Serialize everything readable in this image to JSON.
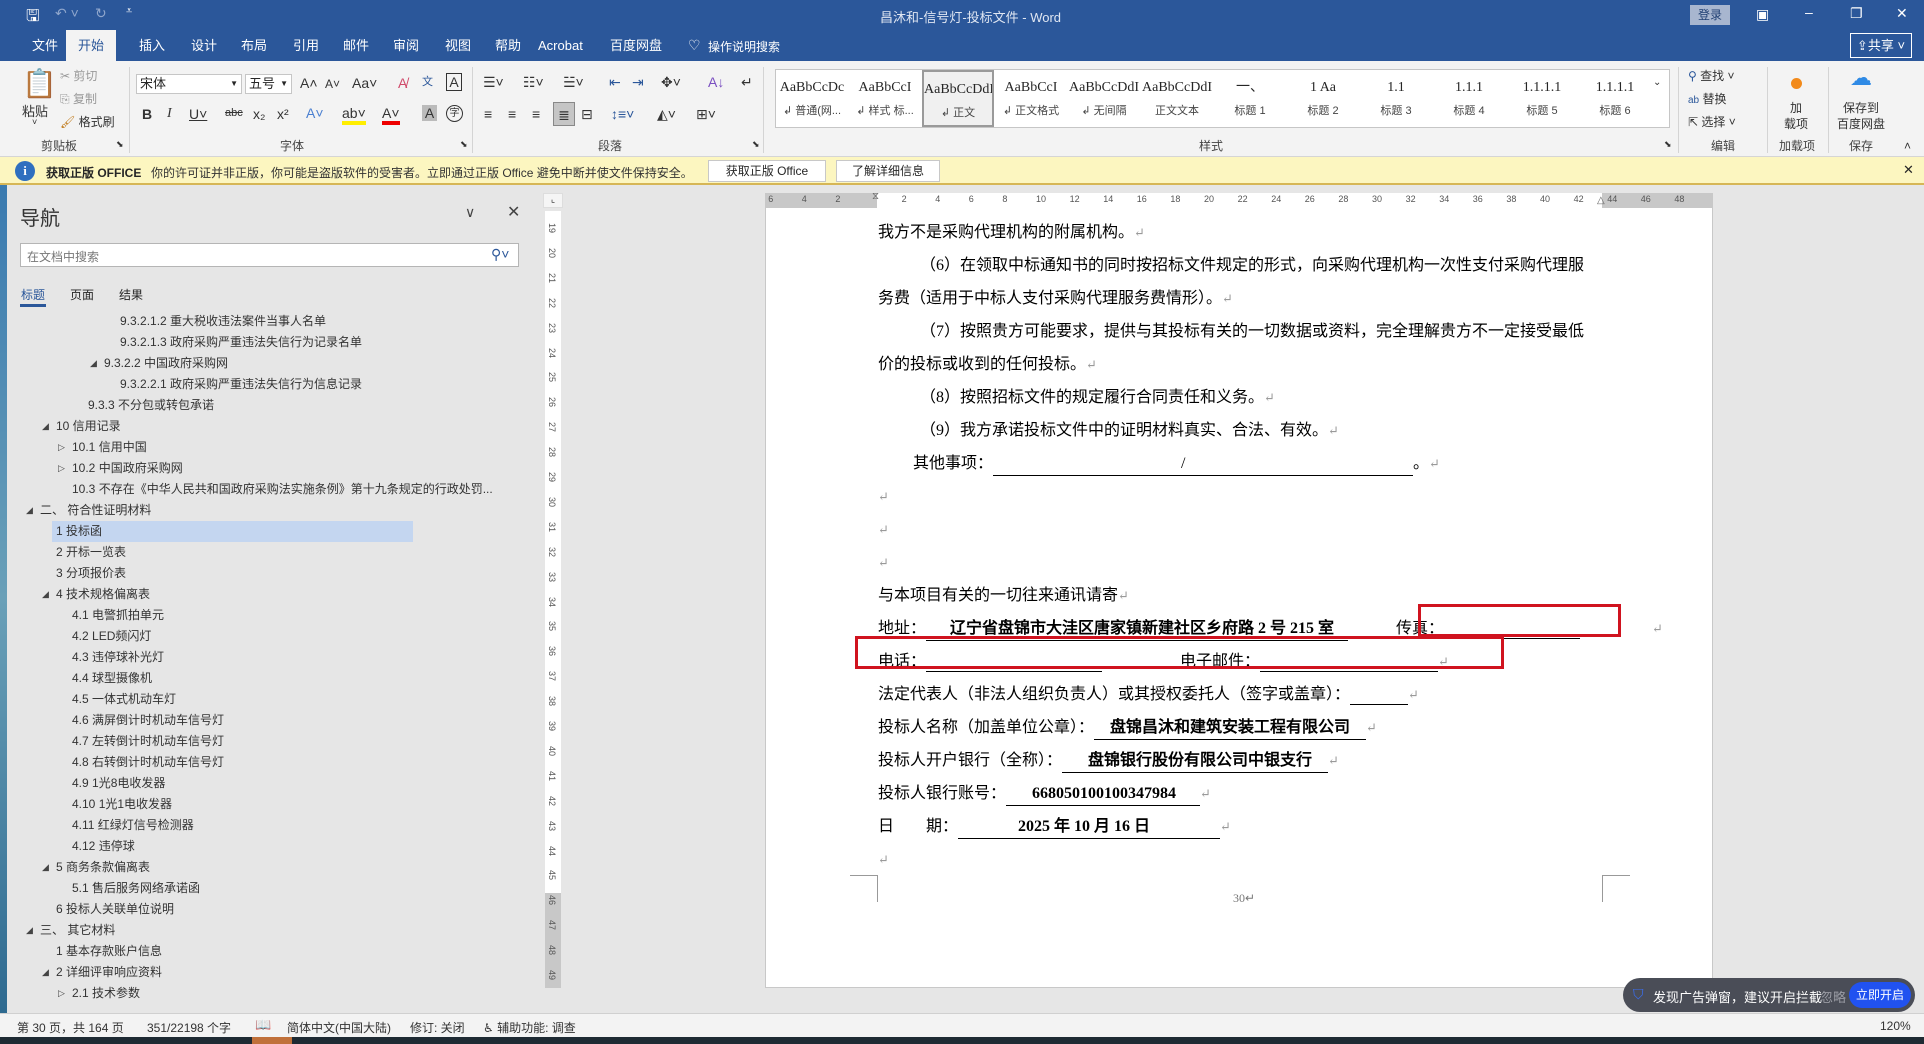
{
  "titlebar": {
    "title": "昌沐和-信号灯-投标文件 - Word",
    "login": "登录",
    "quick_access": [
      "save-icon",
      "undo-icon",
      "redo-icon",
      "customize-icon"
    ]
  },
  "tabs": [
    "文件",
    "开始",
    "插入",
    "设计",
    "布局",
    "引用",
    "邮件",
    "审阅",
    "视图",
    "帮助",
    "Acrobat",
    "百度网盘"
  ],
  "tell_me": "操作说明搜索",
  "share": "共享",
  "ribbon": {
    "clipboard": {
      "label": "剪贴板",
      "paste": "粘贴",
      "cut": "剪切",
      "copy": "复制",
      "format_painter": "格式刷"
    },
    "font": {
      "label": "字体",
      "font_name": "宋体",
      "font_size": "五号"
    },
    "paragraph": {
      "label": "段落"
    },
    "styles": {
      "label": "样式",
      "items": [
        {
          "preview": "AaBbCcDc",
          "label": "↲ 普通(网..."
        },
        {
          "preview": "AaBbCcI",
          "label": "↲ 样式 标..."
        },
        {
          "preview": "AaBbCcDdI",
          "label": "↲ 正文"
        },
        {
          "preview": "AaBbCcI",
          "label": "↲ 正文格式"
        },
        {
          "preview": "AaBbCcDdI",
          "label": "↲ 无间隔"
        },
        {
          "preview": "AaBbCcDdI",
          "label": "正文文本"
        },
        {
          "preview": "一、",
          "label": "标题 1"
        },
        {
          "preview": "1  Aa",
          "label": "标题 2"
        },
        {
          "preview": "1.1",
          "label": "标题 3"
        },
        {
          "preview": "1.1.1",
          "label": "标题 4"
        },
        {
          "preview": "1.1.1.1",
          "label": "标题 5"
        },
        {
          "preview": "1.1.1.1",
          "label": "标题 6"
        }
      ]
    },
    "editing": {
      "label": "编辑",
      "find": "查找",
      "replace": "替换",
      "select": "选择"
    },
    "addins": {
      "label": "加载项",
      "button_line1": "加",
      "button_line2": "载项"
    },
    "save": {
      "label": "保存",
      "button_line1": "保存到",
      "button_line2": "百度网盘"
    }
  },
  "message_bar": {
    "title": "获取正版 OFFICE",
    "text": "你的许可证并非正版，你可能是盗版软件的受害者。立即通过正版 Office 避免中断并使文件保持安全。",
    "btn_genuine": "获取正版 Office",
    "btn_learn": "了解详细信息"
  },
  "nav": {
    "title": "导航",
    "search_placeholder": "在文档中搜索",
    "tabs": [
      "标题",
      "页面",
      "结果"
    ],
    "items": [
      {
        "text": "9.3.2.1.2 重大税收违法案件当事人名单",
        "level": 5,
        "toggle": ""
      },
      {
        "text": "9.3.2.1.3 政府采购严重违法失信行为记录名单",
        "level": 5,
        "toggle": ""
      },
      {
        "text": "9.3.2.2 中国政府采购网",
        "level": 4,
        "toggle": "expanded"
      },
      {
        "text": "9.3.2.2.1 政府采购严重违法失信行为信息记录",
        "level": 5,
        "toggle": ""
      },
      {
        "text": "9.3.3 不分包或转包承诺",
        "level": 3,
        "toggle": ""
      },
      {
        "text": "10 信用记录",
        "level": 1,
        "toggle": "expanded"
      },
      {
        "text": "10.1 信用中国",
        "level": 2,
        "toggle": "collapsed"
      },
      {
        "text": "10.2 中国政府采购网",
        "level": 2,
        "toggle": "collapsed"
      },
      {
        "text": "10.3 不存在《中华人民共和国政府采购法实施条例》第十九条规定的行政处罚...",
        "level": 2,
        "toggle": ""
      },
      {
        "text": "二、 符合性证明材料",
        "level": 0,
        "toggle": "expanded"
      },
      {
        "text": "1 投标函",
        "level": 1,
        "toggle": "",
        "selected": true
      },
      {
        "text": "2 开标一览表",
        "level": 1,
        "toggle": ""
      },
      {
        "text": "3 分项报价表",
        "level": 1,
        "toggle": ""
      },
      {
        "text": "4 技术规格偏离表",
        "level": 1,
        "toggle": "expanded"
      },
      {
        "text": "4.1 电警抓拍单元",
        "level": 2,
        "toggle": ""
      },
      {
        "text": "4.2 LED频闪灯",
        "level": 2,
        "toggle": ""
      },
      {
        "text": "4.3 违停球补光灯",
        "level": 2,
        "toggle": ""
      },
      {
        "text": "4.4 球型摄像机",
        "level": 2,
        "toggle": ""
      },
      {
        "text": "4.5 一体式机动车灯",
        "level": 2,
        "toggle": ""
      },
      {
        "text": "4.6 满屏倒计时机动车信号灯",
        "level": 2,
        "toggle": ""
      },
      {
        "text": "4.7 左转倒计时机动车信号灯",
        "level": 2,
        "toggle": ""
      },
      {
        "text": "4.8 右转倒计时机动车信号灯",
        "level": 2,
        "toggle": ""
      },
      {
        "text": "4.9 1光8电收发器",
        "level": 2,
        "toggle": ""
      },
      {
        "text": "4.10 1光1电收发器",
        "level": 2,
        "toggle": ""
      },
      {
        "text": "4.11 红绿灯信号检测器",
        "level": 2,
        "toggle": ""
      },
      {
        "text": "4.12 违停球",
        "level": 2,
        "toggle": ""
      },
      {
        "text": "5 商务条款偏离表",
        "level": 1,
        "toggle": "expanded"
      },
      {
        "text": "5.1 售后服务网络承诺函",
        "level": 2,
        "toggle": ""
      },
      {
        "text": "6 投标人关联单位说明",
        "level": 1,
        "toggle": ""
      },
      {
        "text": "三、 其它材料",
        "level": 0,
        "toggle": "expanded"
      },
      {
        "text": "1 基本存款账户信息",
        "level": 1,
        "toggle": ""
      },
      {
        "text": "2 详细评审响应资料",
        "level": 1,
        "toggle": "expanded"
      },
      {
        "text": "2.1 技术参数",
        "level": 2,
        "toggle": "collapsed"
      }
    ]
  },
  "ruler": {
    "h_left": [
      "6",
      "4",
      "2"
    ],
    "h_right": [
      "2",
      "4",
      "6",
      "8",
      "10",
      "12",
      "14",
      "16",
      "18",
      "20",
      "22",
      "24",
      "26",
      "28",
      "30",
      "32",
      "34",
      "36",
      "38",
      "40",
      "42",
      "44",
      "46",
      "48"
    ],
    "v": [
      "19",
      "20",
      "21",
      "22",
      "23",
      "24",
      "25",
      "26",
      "27",
      "28",
      "29",
      "30",
      "31",
      "32",
      "33",
      "34",
      "35",
      "36",
      "37",
      "38",
      "39",
      "40",
      "41",
      "42",
      "43",
      "44",
      "45",
      "46",
      "47",
      "48",
      "49"
    ]
  },
  "document": {
    "l1": "我方不是采购代理机构的附属机构。",
    "l2": "（6）在领取中标通知书的同时按招标文件规定的形式，向采购代理机构一次性支付采购代理服",
    "l3": "务费（适用于中标人支付采购代理服务费情形）。",
    "l4": "（7）按照贵方可能要求，提供与其投标有关的一切数据或资料，完全理解贵方不一定接受最低",
    "l5": "价的投标或收到的任何投标。",
    "l6": "（8）按照招标文件的规定履行合同责任和义务。",
    "l7": "（9）我方承诺投标文件中的证明材料真实、合法、有效。",
    "other_label": "其他事项：",
    "other_value": "/",
    "contact_intro": "与本项目有关的一切往来通讯请寄",
    "address_label": "地址：",
    "address_value": "辽宁省盘锦市大洼区唐家镇新建社区乡府路 2 号 215 室",
    "fax_label": "传真：",
    "phone_label": "电话：",
    "email_label": "电子邮件：",
    "legal_rep_label": "法定代表人（非法人组织负责人）或其授权委托人（签字或盖章）：",
    "bidder_name_label": "投标人名称（加盖单位公章）：",
    "bidder_name_value": "盘锦昌沐和建筑安装工程有限公司",
    "bank_label": "投标人开户银行（全称）：",
    "bank_value": "盘锦银行股份有限公司中银支行",
    "account_label": "投标人银行账号：",
    "account_value": "668050100100347984",
    "date_label": "日　　期：",
    "date_value": "2025 年 10 月 16 日",
    "page_number": "30"
  },
  "status": {
    "page": "第 30 页，共 164 页",
    "words": "351/22198 个字",
    "language": "简体中文(中国大陆)",
    "track_changes": "修订: 关闭",
    "accessibility": "辅助功能: 调查",
    "zoom": "120%"
  },
  "popup": {
    "text": "发现广告弹窗，建议开启拦截",
    "ignore": "忽略",
    "enable": "立即开启"
  },
  "colors": {
    "title_bg": "#2b579a",
    "highlight_red": "#d0131f",
    "nav_selected": "#c4d6f0",
    "popup_button": "#2152f0"
  }
}
